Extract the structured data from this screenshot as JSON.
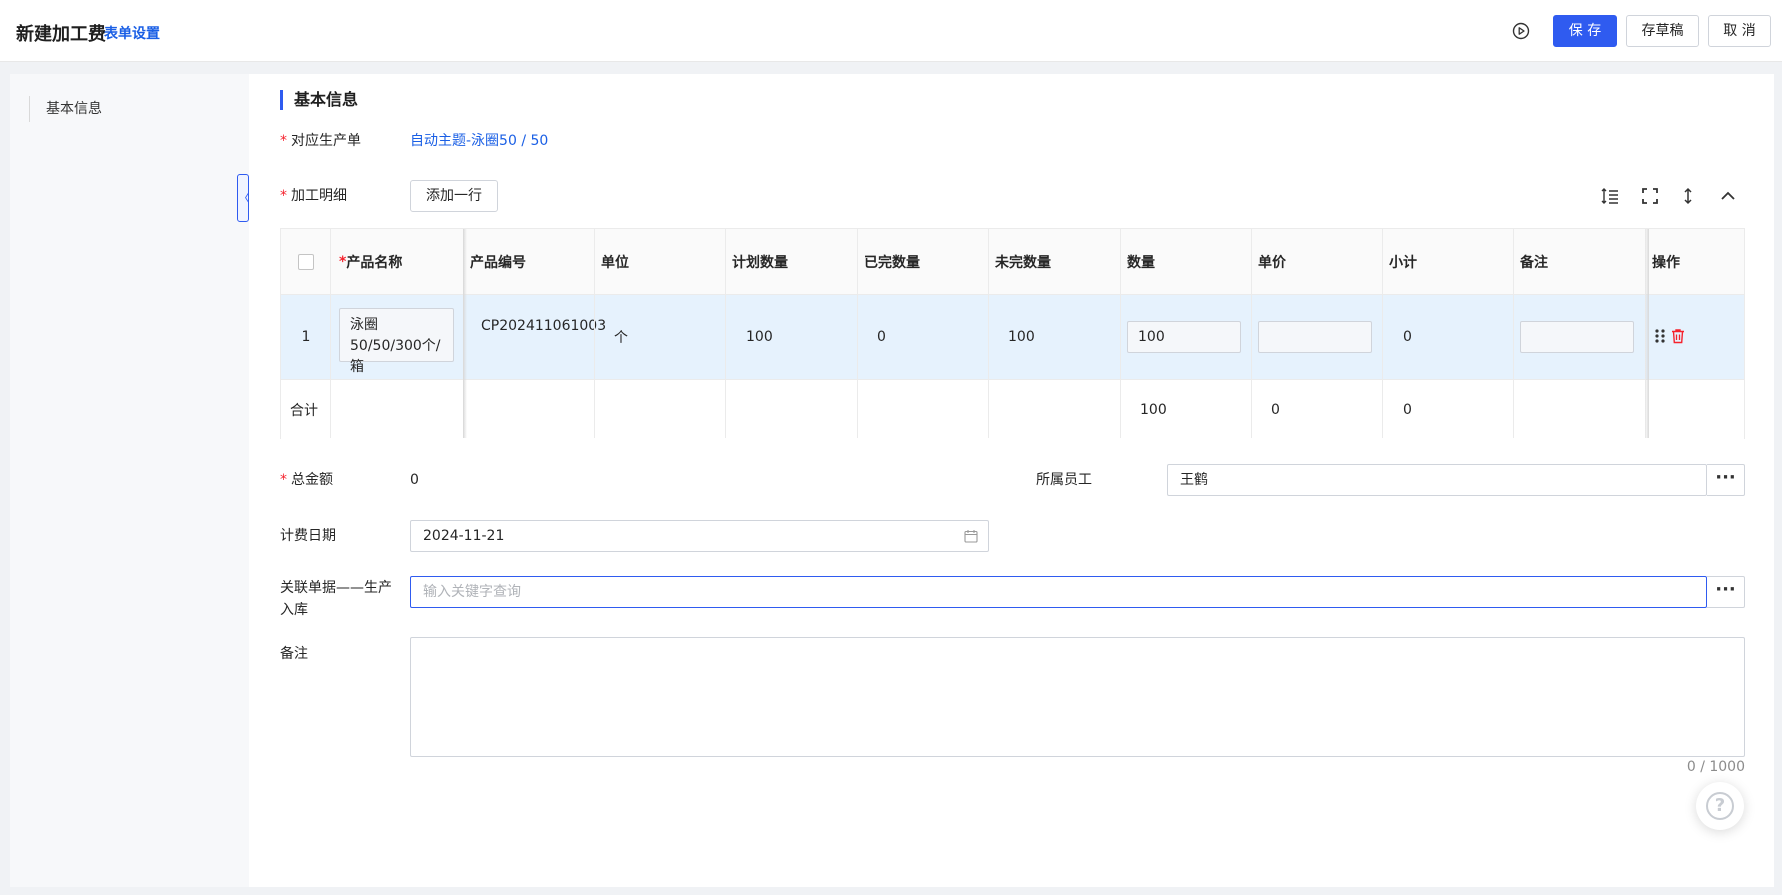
{
  "header": {
    "title": "新建加工费",
    "form_settings": "表单设置",
    "play_icon": "play-circle-icon",
    "save": "保 存",
    "draft": "存草稿",
    "cancel": "取 消"
  },
  "sidebar": {
    "items": [
      {
        "label": "基本信息"
      }
    ],
    "collapse_glyph": "〈"
  },
  "section": {
    "title": "基本信息"
  },
  "form": {
    "production_order": {
      "required_mark": "*",
      "label": "对应生产单",
      "value": "自动主题-泳圈50 / 50"
    },
    "details": {
      "required_mark": "*",
      "label": "加工明细",
      "add_row": "添加一行"
    },
    "total": {
      "required_mark": "*",
      "label": "总金额",
      "value": "0"
    },
    "employee": {
      "label": "所属员工",
      "value": "王鹤"
    },
    "billing_date": {
      "label": "计费日期",
      "value": "2024-11-21"
    },
    "related_doc": {
      "label": "关联单据——生产入库",
      "placeholder": "输入关键字查询"
    },
    "remark": {
      "label": "备注",
      "counter": "0 / 1000"
    }
  },
  "toolbar_icons": [
    "row-height-icon",
    "fullscreen-icon",
    "vertical-resize-icon",
    "collapse-up-icon"
  ],
  "table": {
    "columns": {
      "name_required": "*",
      "name": "产品名称",
      "code": "产品编号",
      "unit": "单位",
      "planned": "计划数量",
      "done": "已完数量",
      "undone": "未完数量",
      "qty": "数量",
      "price": "单价",
      "subtotal": "小计",
      "note": "备注",
      "actions": "操作"
    },
    "row": {
      "index": "1",
      "name": "泳圈50/50/300个/箱",
      "code": "CP202411061003",
      "unit": "个",
      "planned": "100",
      "done": "0",
      "undone": "100",
      "qty": "100",
      "price": "",
      "subtotal": "0",
      "note": ""
    },
    "summary": {
      "label": "合计",
      "qty": "100",
      "price": "0",
      "subtotal": "0"
    }
  },
  "colors": {
    "primary": "#2f5bf0",
    "link": "#1a5fe5",
    "row_highlight": "#e6f2fd",
    "danger": "#f5222d"
  }
}
